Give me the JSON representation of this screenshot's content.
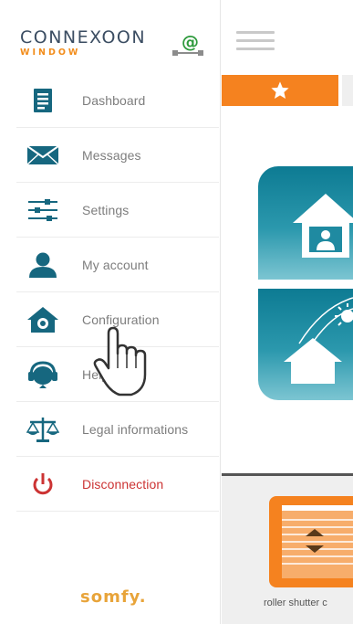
{
  "brand": {
    "name": "CONNEXOON",
    "sub": "WINDOW"
  },
  "menu": [
    {
      "label": "Dashboard",
      "icon": "dashboard-icon"
    },
    {
      "label": "Messages",
      "icon": "envelope-icon"
    },
    {
      "label": "Settings",
      "icon": "sliders-icon"
    },
    {
      "label": "My account",
      "icon": "user-icon"
    },
    {
      "label": "Configuration",
      "icon": "house-gear-icon"
    },
    {
      "label": "Help",
      "icon": "headset-icon"
    },
    {
      "label": "Legal informations",
      "icon": "scales-icon"
    },
    {
      "label": "Disconnection",
      "icon": "power-icon"
    }
  ],
  "footer": {
    "logo": "somfy."
  },
  "main": {
    "tabs": [
      {
        "icon": "star-icon",
        "active": true
      }
    ],
    "tiles": [
      {
        "icon": "home-user-icon"
      },
      {
        "icon": "home-sun-icon"
      }
    ],
    "device": {
      "label": "roller shutter c"
    }
  },
  "colors": {
    "accent": "#f5821f",
    "primary": "#16677f",
    "danger": "#cc3333",
    "tile": "#2b98ad"
  }
}
